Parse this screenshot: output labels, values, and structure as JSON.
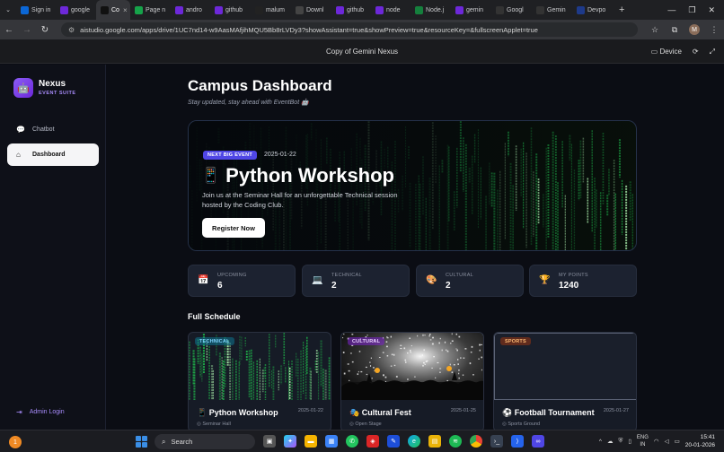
{
  "browser": {
    "tabs": [
      {
        "label": "Sign in",
        "icon": "skype-icon",
        "color": "#0b67d6"
      },
      {
        "label": "google",
        "icon": "phind-icon",
        "color": "#6d28d9"
      },
      {
        "label": "Co",
        "icon": "studio-icon",
        "color": "#111111",
        "active": true
      },
      {
        "label": "Page n",
        "icon": "drive-icon",
        "color": "#16a34a"
      },
      {
        "label": "andro",
        "icon": "phind-icon",
        "color": "#6d28d9"
      },
      {
        "label": "github",
        "icon": "phind-icon",
        "color": "#6d28d9"
      },
      {
        "label": "malum",
        "icon": "github-icon",
        "color": "#222222"
      },
      {
        "label": "Downl",
        "icon": "download-icon",
        "color": "#444444"
      },
      {
        "label": "github",
        "icon": "phind-icon",
        "color": "#6d28d9"
      },
      {
        "label": "node",
        "icon": "phind-icon",
        "color": "#6d28d9"
      },
      {
        "label": "Node.j",
        "icon": "node-icon",
        "color": "#15803d"
      },
      {
        "label": "gemin",
        "icon": "phind-icon",
        "color": "#6d28d9"
      },
      {
        "label": "Googl",
        "icon": "gemini-icon",
        "color": "#333333"
      },
      {
        "label": "Gemin",
        "icon": "globe-icon",
        "color": "#333333"
      },
      {
        "label": "Devpo",
        "icon": "devpost-icon",
        "color": "#1e3a8a"
      }
    ],
    "close_glyph": "×",
    "new_tab_glyph": "+",
    "url": "aistudio.google.com/apps/drive/1UC7nd14-w9AasMAfjihMQU5Bb8rLVDy3?showAssistant=true&showPreview=true&resourceKey=&fullscreenApplet=true",
    "profile_initial": "M"
  },
  "studio": {
    "title": "Copy of Gemini Nexus",
    "device_label": "Device"
  },
  "sidebar": {
    "brand": "Nexus",
    "brand_sub": "EVENT SUITE",
    "items": [
      {
        "label": "Chatbot",
        "icon": "chat-icon"
      },
      {
        "label": "Dashboard",
        "icon": "home-icon",
        "active": true
      }
    ],
    "admin_label": "Admin Login"
  },
  "main": {
    "title": "Campus Dashboard",
    "subtitle": "Stay updated, stay ahead with EventBot 🤖",
    "hero": {
      "badge": "NEXT BIG EVENT",
      "date": "2025-01-22",
      "emoji": "📱",
      "title": "Python Workshop",
      "description": "Join us at the Seminar Hall for an unforgettable Technical session hosted by the Coding Club.",
      "button": "Register Now"
    },
    "stats": [
      {
        "label": "UPCOMING",
        "value": "6",
        "icon": "📅"
      },
      {
        "label": "TECHNICAL",
        "value": "2",
        "icon": "💻"
      },
      {
        "label": "CULTURAL",
        "value": "2",
        "icon": "🎨"
      },
      {
        "label": "MY POINTS",
        "value": "1240",
        "icon": "🏆"
      }
    ],
    "schedule_title": "Full Schedule",
    "events": [
      {
        "tag": "TECHNICAL",
        "tag_color": "#38bdf8",
        "emoji": "📱",
        "title": "Python Workshop",
        "date": "2025-01-22",
        "location": "Seminar Hall"
      },
      {
        "tag": "CULTURAL",
        "tag_color": "#c084fc",
        "emoji": "🎭",
        "title": "Cultural Fest",
        "date": "2025-01-25",
        "location": "Open Stage"
      },
      {
        "tag": "SPORTS",
        "tag_color": "#fb923c",
        "emoji": "⚽",
        "title": "Football Tournament",
        "date": "2025-01-27",
        "location": "Sports Ground"
      }
    ]
  },
  "taskbar": {
    "weather_badge": "1",
    "search_placeholder": "Search",
    "lang_top": "ENG",
    "lang_bottom": "IN",
    "time": "15:41",
    "date": "20-01-2026"
  }
}
